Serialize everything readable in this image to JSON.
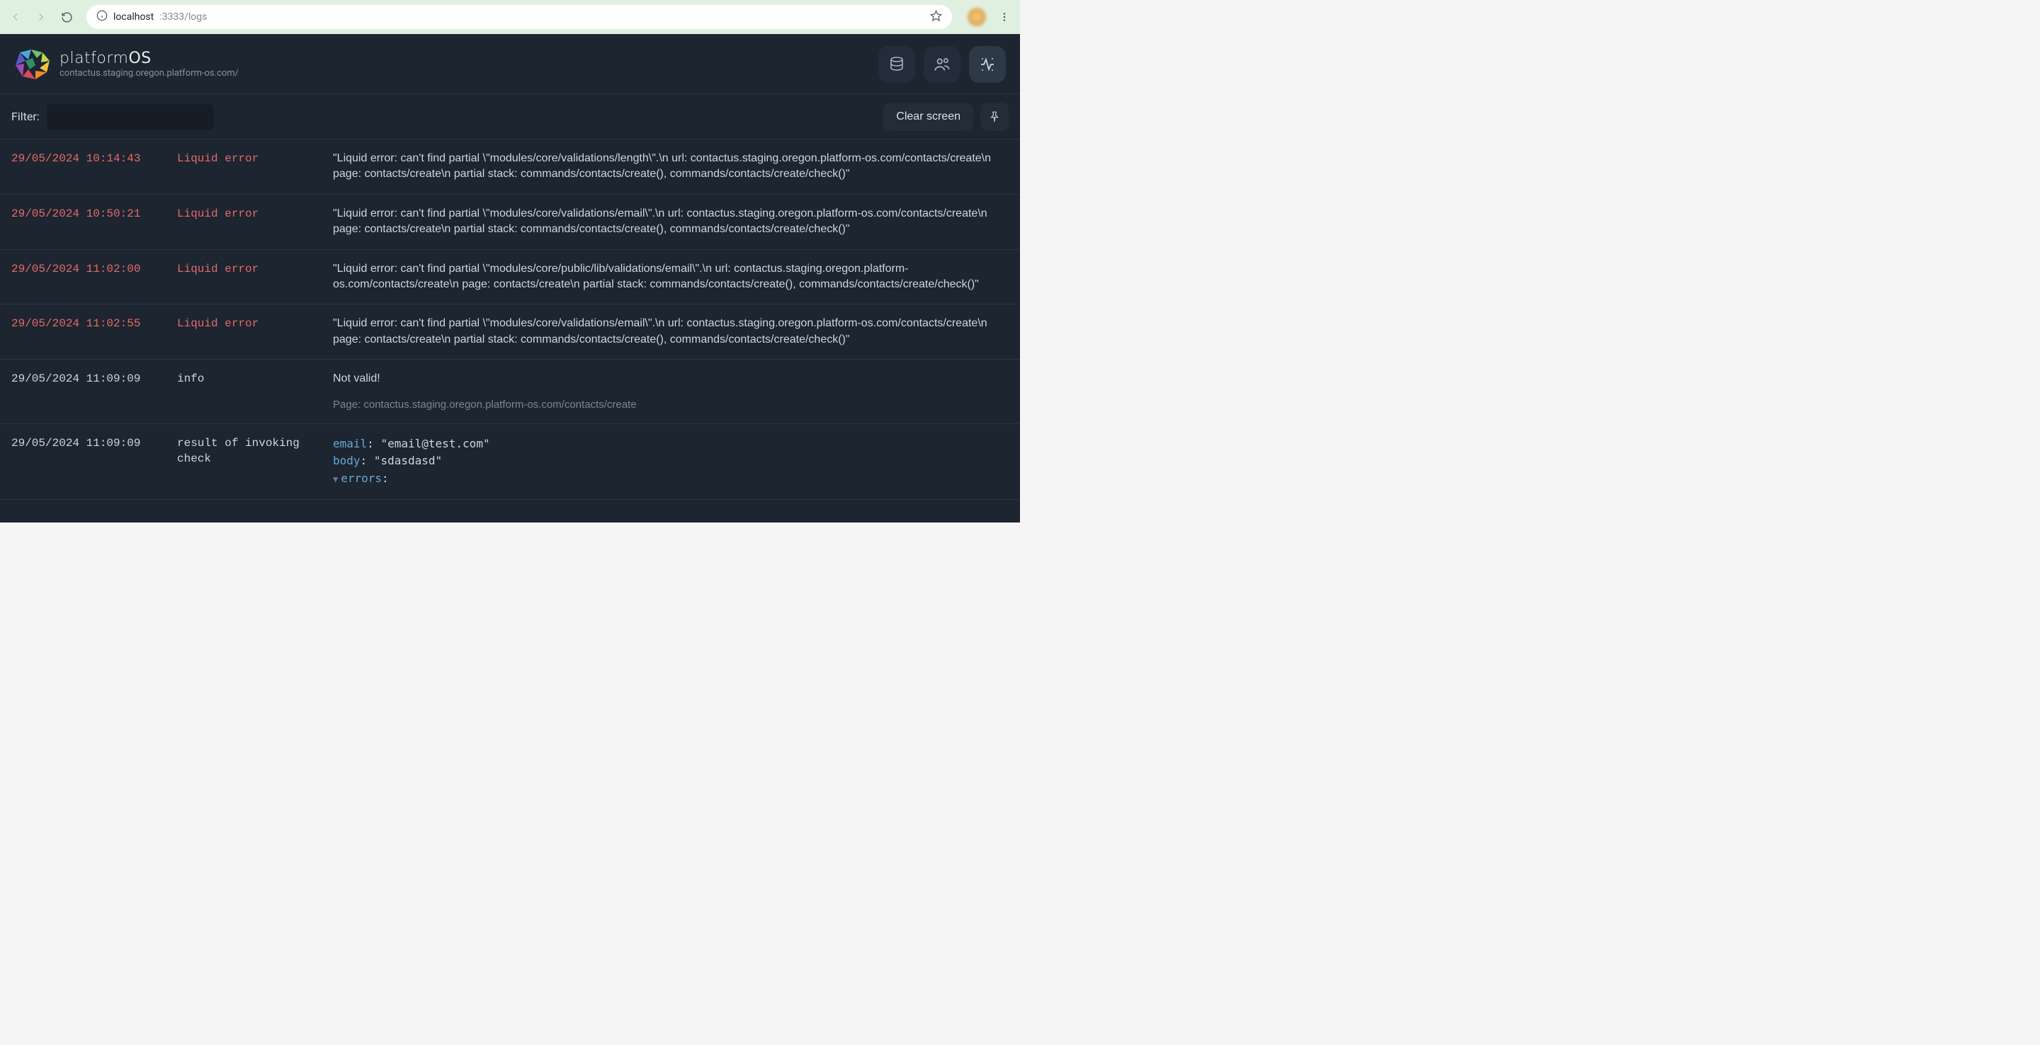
{
  "browser": {
    "url_host": "localhost",
    "url_port_path": ":3333/logs"
  },
  "brand": {
    "name_a": "platform",
    "name_b": "OS",
    "sub": "contactus.staging.oregon.platform-os.com/"
  },
  "filter": {
    "label": "Filter:",
    "clear": "Clear screen"
  },
  "logs": [
    {
      "ts": "29/05/2024 10:14:43",
      "type": "Liquid error",
      "kind": "err",
      "msg": "\"Liquid error: can't find partial \\\"modules/core/validations/length\\\".\\n url: contactus.staging.oregon.platform-os.com/contacts/create\\n page: contacts/create\\n partial stack: commands/contacts/create(), commands/contacts/create/check()\""
    },
    {
      "ts": "29/05/2024 10:50:21",
      "type": "Liquid error",
      "kind": "err",
      "msg": "\"Liquid error: can't find partial \\\"modules/core/validations/email\\\".\\n url: contactus.staging.oregon.platform-os.com/contacts/create\\n page: contacts/create\\n partial stack: commands/contacts/create(), commands/contacts/create/check()\""
    },
    {
      "ts": "29/05/2024 11:02:00",
      "type": "Liquid error",
      "kind": "err",
      "msg": "\"Liquid error: can't find partial \\\"modules/core/public/lib/validations/email\\\".\\n url: contactus.staging.oregon.platform-os.com/contacts/create\\n page: contacts/create\\n partial stack: commands/contacts/create(), commands/contacts/create/check()\""
    },
    {
      "ts": "29/05/2024 11:02:55",
      "type": "Liquid error",
      "kind": "err",
      "msg": "\"Liquid error: can't find partial \\\"modules/core/validations/email\\\".\\n url: contactus.staging.oregon.platform-os.com/contacts/create\\n page: contacts/create\\n partial stack: commands/contacts/create(), commands/contacts/create/check()\""
    },
    {
      "ts": "29/05/2024 11:09:09",
      "type": "info",
      "kind": "info",
      "msg": "Not valid!",
      "sub": "Page: contactus.staging.oregon.platform-os.com/contacts/create"
    },
    {
      "ts": "29/05/2024 11:09:09",
      "type": "result of invoking check",
      "kind": "info",
      "dump": {
        "email": "\"email@test.com\"",
        "body": "\"sdasdasd\"",
        "errors_key": "errors"
      }
    }
  ]
}
